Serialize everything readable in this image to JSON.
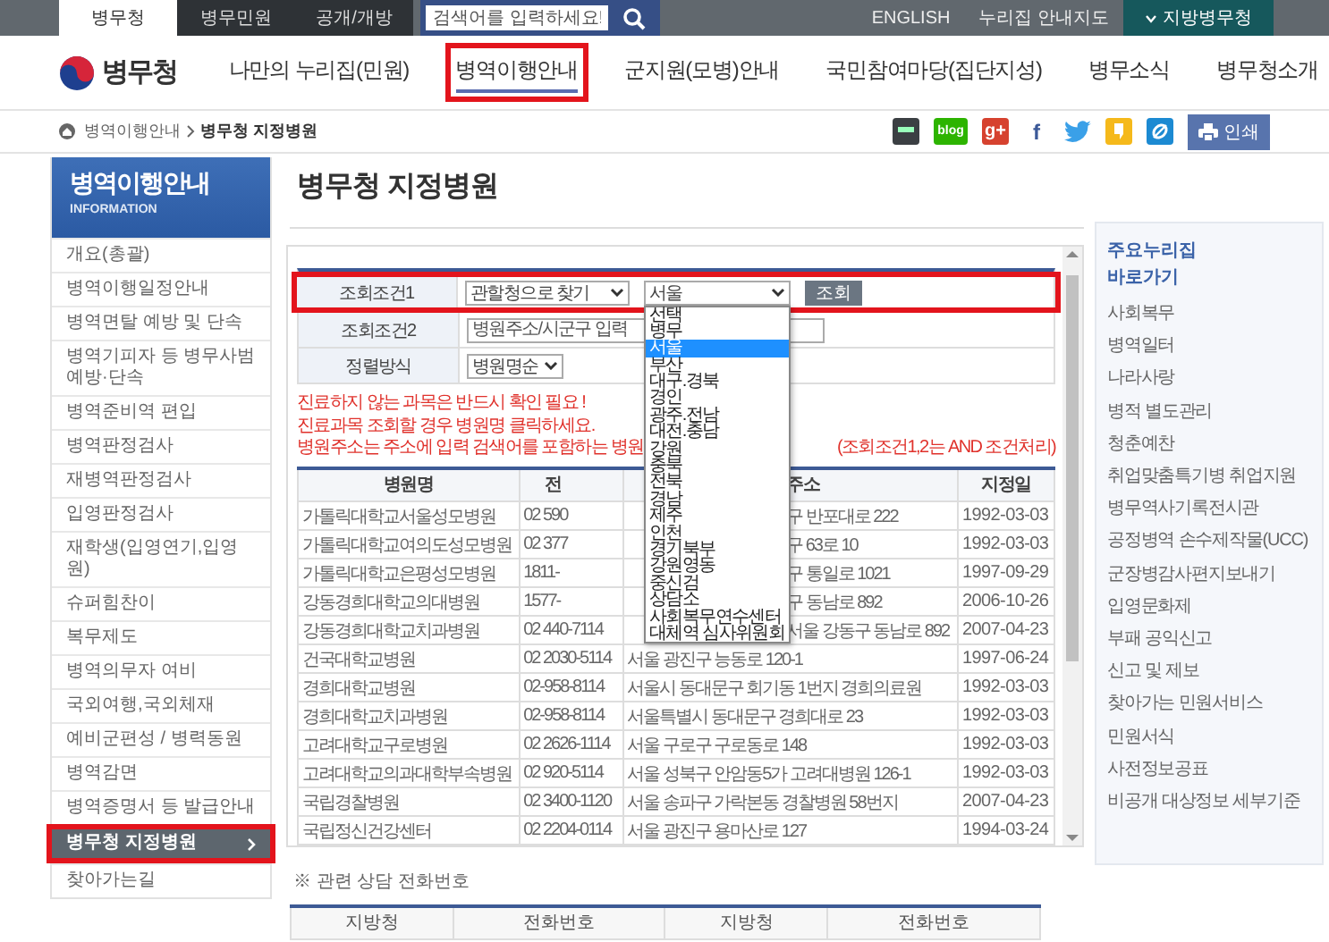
{
  "top_bar": {
    "tabs": [
      {
        "label": "병무청",
        "selected": true
      },
      {
        "label": "병무민원",
        "selected": false
      },
      {
        "label": "공개/개방",
        "selected": false
      }
    ],
    "search": {
      "placeholder": "검색어를 입력하세요!"
    },
    "links": [
      "ENGLISH",
      "누리집 안내지도"
    ],
    "regional_button": "지방병무청"
  },
  "header": {
    "logo": "병무청",
    "nav": [
      {
        "label": "나만의 누리집(민원)",
        "selected": false,
        "annotated": false
      },
      {
        "label": "병역이행안내",
        "selected": true,
        "annotated": true
      },
      {
        "label": "군지원(모병)안내",
        "selected": false,
        "annotated": false
      },
      {
        "label": "국민참여마당(집단지성)",
        "selected": false,
        "annotated": false
      },
      {
        "label": "병무소식",
        "selected": false,
        "annotated": false
      },
      {
        "label": "병무청소개",
        "selected": false,
        "annotated": false
      }
    ]
  },
  "breadcrumb": [
    "병역이행안내",
    "병무청 지정병원"
  ],
  "share_links": [
    {
      "kind": "app"
    },
    {
      "kind": "blog",
      "text": "blog"
    },
    {
      "kind": "google",
      "text": "g+"
    },
    {
      "kind": "facebook",
      "text": "f"
    },
    {
      "kind": "twitter"
    },
    {
      "kind": "story"
    },
    {
      "kind": "link"
    }
  ],
  "print_button": "인쇄",
  "sidebar": {
    "title": "병역이행안내",
    "subtitle": "INFORMATION",
    "items": [
      {
        "label": "개요(총괄)",
        "selected": false,
        "annotated": false
      },
      {
        "label": "병역이행일정안내",
        "selected": false,
        "annotated": false
      },
      {
        "label": "병역면탈 예방 및 단속",
        "selected": false,
        "annotated": false
      },
      {
        "label": "병역기피자 등 병무사범 예방·단속",
        "selected": false,
        "annotated": false
      },
      {
        "label": "병역준비역 편입",
        "selected": false,
        "annotated": false
      },
      {
        "label": "병역판정검사",
        "selected": false,
        "annotated": false
      },
      {
        "label": "재병역판정검사",
        "selected": false,
        "annotated": false
      },
      {
        "label": "입영판정검사",
        "selected": false,
        "annotated": false
      },
      {
        "label": "재학생(입영연기,입영원)",
        "selected": false,
        "annotated": false
      },
      {
        "label": "슈퍼힘찬이",
        "selected": false,
        "annotated": false
      },
      {
        "label": "복무제도",
        "selected": false,
        "annotated": false
      },
      {
        "label": "병역의무자 여비",
        "selected": false,
        "annotated": false
      },
      {
        "label": "국외여행,국외체재",
        "selected": false,
        "annotated": false
      },
      {
        "label": "예비군편성 / 병력동원",
        "selected": false,
        "annotated": false
      },
      {
        "label": "병역감면",
        "selected": false,
        "annotated": false
      },
      {
        "label": "병역증명서 등 발급안내",
        "selected": false,
        "annotated": false
      },
      {
        "label": "병무청 지정병원",
        "selected": true,
        "annotated": true
      },
      {
        "label": "찾아가는길",
        "selected": false,
        "annotated": false
      }
    ]
  },
  "page_title": "병무청 지정병원",
  "search_form": {
    "rows": [
      {
        "kind": "selects",
        "label": "조회조건1",
        "annotated": true,
        "select_1": "관할청으로 찾기",
        "select_2": "서울",
        "button": "조회",
        "open": true,
        "options": [
          {
            "label": "선택",
            "selected": false
          },
          {
            "label": "병무",
            "selected": false
          },
          {
            "label": "서울",
            "selected": true
          },
          {
            "label": "부산",
            "selected": false
          },
          {
            "label": "대구.경북",
            "selected": false
          },
          {
            "label": "경인",
            "selected": false
          },
          {
            "label": "광주.전남",
            "selected": false
          },
          {
            "label": "대전.충남",
            "selected": false
          },
          {
            "label": "강원",
            "selected": false
          },
          {
            "label": "충북",
            "selected": false
          },
          {
            "label": "전북",
            "selected": false
          },
          {
            "label": "경남",
            "selected": false
          },
          {
            "label": "제주",
            "selected": false
          },
          {
            "label": "인천",
            "selected": false
          },
          {
            "label": "경기북부",
            "selected": false
          },
          {
            "label": "강원영동",
            "selected": false
          },
          {
            "label": "중신검",
            "selected": false
          },
          {
            "label": "상담소",
            "selected": false
          },
          {
            "label": "사회복무연수센터",
            "selected": false
          },
          {
            "label": "대체역 심사위원회",
            "selected": false
          }
        ]
      },
      {
        "kind": "input",
        "label": "조회조건2",
        "annotated": false,
        "placeholder": "병원주소/시군구 입력"
      },
      {
        "kind": "select",
        "label": "정렬방식",
        "annotated": false,
        "value": "병원명순"
      }
    ]
  },
  "notes": [
    [
      "진료하지 않는 과목은 반드시 확인 필요 !"
    ],
    [
      "진료과목 조회할 경우 병원명 클릭하세요."
    ],
    [
      "병원주소는 주소에 입력 검색어를 포함하는 병원",
      "(조회조건1,2는 AND 조건처리)"
    ]
  ],
  "table": {
    "columns": [
      "병원명",
      "전",
      "주소",
      "지정일"
    ],
    "rows": [
      [
        "가톨릭대학교서울성모병원",
        "02 590",
        "구 반포대로 222",
        "1992-03-03"
      ],
      [
        "가톨릭대학교여의도성모병원",
        "02 377",
        "구 63로 10",
        "1992-03-03"
      ],
      [
        "가톨릭대학교은평성모병원",
        "1811-",
        "구 통일로 1021",
        "1997-09-29"
      ],
      [
        "강동경희대학교의대병원",
        "1577-",
        "구 동남로 892",
        "2006-10-26"
      ],
      [
        "강동경희대학교치과병원",
        "02 440-7114",
        "서울 강동구 동남로 892",
        "2007-04-23"
      ],
      [
        "건국대학교병원",
        "02 2030-5114",
        "서울 광진구 능동로 120-1",
        "1997-06-24"
      ],
      [
        "경희대학교병원",
        "02-958-8114",
        "서울시 동대문구 회기동 1번지 경희의료원",
        "1992-03-03"
      ],
      [
        "경희대학교치과병원",
        "02-958-8114",
        "서울특별시 동대문구 경희대로 23",
        "1992-03-03"
      ],
      [
        "고려대학교구로병원",
        "02 2626-1114",
        "서울 구로구 구로동로 148",
        "1992-03-03"
      ],
      [
        "고려대학교의과대학부속병원",
        "02 920-5114",
        "서울 성북구 안암동5가 고려대병원 126-1",
        "1992-03-03"
      ],
      [
        "국립경찰병원",
        "02 3400-1120",
        "서울 송파구 가락본동 경찰병원 58번지",
        "2007-04-23"
      ],
      [
        "국립정신건강센터",
        "02 2204-0114",
        "서울 광진구 용마산로 127",
        "1994-03-24"
      ]
    ]
  },
  "contacts": {
    "title": "※ 관련 상담 전화번호",
    "columns": [
      "지방청",
      "전화번호",
      "지방청",
      "전화번호"
    ]
  },
  "quick_links": {
    "title": "주요누리집 바로가기",
    "items": [
      "사회복무",
      "병역일터",
      "나라사랑",
      "병적 별도관리",
      "청춘예찬",
      "취업맞춤특기병 취업지원",
      "병무역사기록전시관",
      "공정병역 손수제작물(UCC)",
      "군장병감사편지보내기",
      "입영문화제",
      "부패 공익신고",
      "신고 및 제보",
      "찾아가는 민원서비스",
      "민원서식",
      "사전정보공표",
      "비공개 대상정보 세부기준"
    ]
  }
}
